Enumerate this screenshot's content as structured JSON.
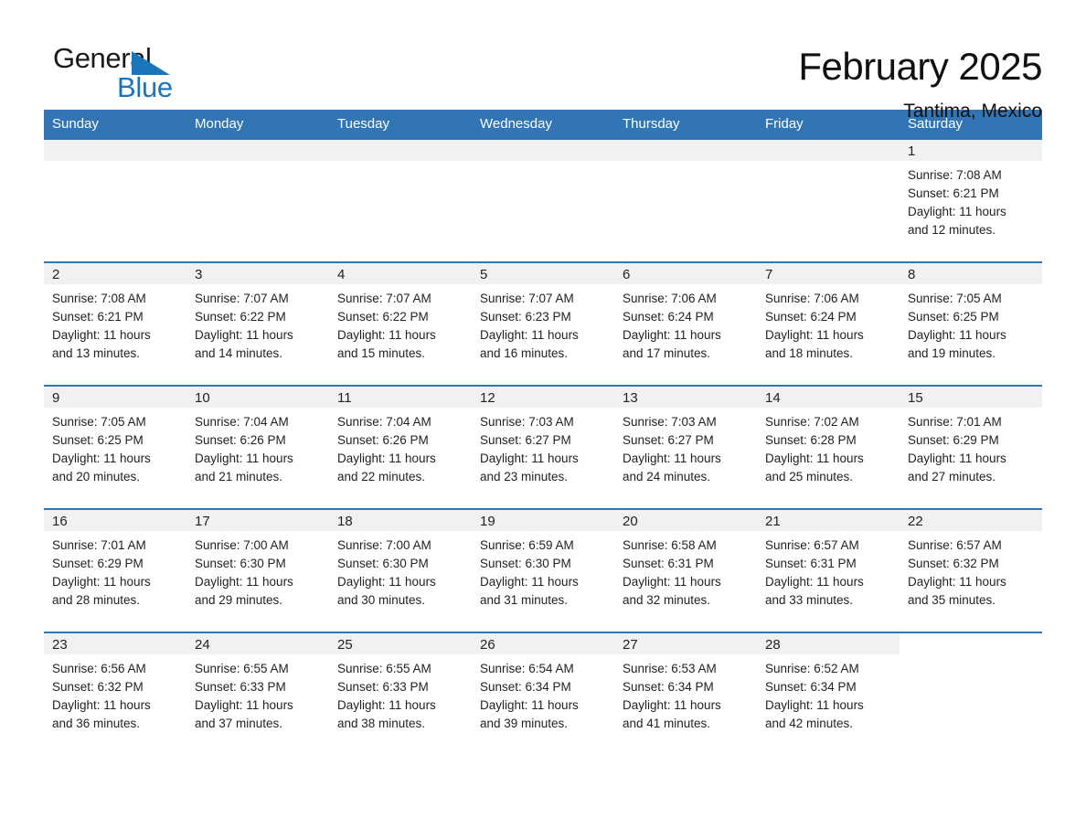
{
  "logo": {
    "word_general": "General",
    "word_blue": "Blue",
    "triangle_color": "#1b75bb"
  },
  "header": {
    "month_title": "February 2025",
    "location": "Tantima, Mexico"
  },
  "theme": {
    "header_blue": "#3175b4",
    "row_border_blue": "#3175b4",
    "daynum_band": "#f1f1f1",
    "text": "#222222"
  },
  "calendar": {
    "weekday_headers": [
      "Sunday",
      "Monday",
      "Tuesday",
      "Wednesday",
      "Thursday",
      "Friday",
      "Saturday"
    ],
    "weeks": [
      [
        {
          "day": "",
          "sunrise": "",
          "sunset": "",
          "daylight_line1": "",
          "daylight_line2": "",
          "blank": true
        },
        {
          "day": "",
          "sunrise": "",
          "sunset": "",
          "daylight_line1": "",
          "daylight_line2": "",
          "blank": true
        },
        {
          "day": "",
          "sunrise": "",
          "sunset": "",
          "daylight_line1": "",
          "daylight_line2": "",
          "blank": true
        },
        {
          "day": "",
          "sunrise": "",
          "sunset": "",
          "daylight_line1": "",
          "daylight_line2": "",
          "blank": true
        },
        {
          "day": "",
          "sunrise": "",
          "sunset": "",
          "daylight_line1": "",
          "daylight_line2": "",
          "blank": true
        },
        {
          "day": "",
          "sunrise": "",
          "sunset": "",
          "daylight_line1": "",
          "daylight_line2": "",
          "blank": true
        },
        {
          "day": "1",
          "sunrise": "Sunrise: 7:08 AM",
          "sunset": "Sunset: 6:21 PM",
          "daylight_line1": "Daylight: 11 hours",
          "daylight_line2": "and 12 minutes."
        }
      ],
      [
        {
          "day": "2",
          "sunrise": "Sunrise: 7:08 AM",
          "sunset": "Sunset: 6:21 PM",
          "daylight_line1": "Daylight: 11 hours",
          "daylight_line2": "and 13 minutes."
        },
        {
          "day": "3",
          "sunrise": "Sunrise: 7:07 AM",
          "sunset": "Sunset: 6:22 PM",
          "daylight_line1": "Daylight: 11 hours",
          "daylight_line2": "and 14 minutes."
        },
        {
          "day": "4",
          "sunrise": "Sunrise: 7:07 AM",
          "sunset": "Sunset: 6:22 PM",
          "daylight_line1": "Daylight: 11 hours",
          "daylight_line2": "and 15 minutes."
        },
        {
          "day": "5",
          "sunrise": "Sunrise: 7:07 AM",
          "sunset": "Sunset: 6:23 PM",
          "daylight_line1": "Daylight: 11 hours",
          "daylight_line2": "and 16 minutes."
        },
        {
          "day": "6",
          "sunrise": "Sunrise: 7:06 AM",
          "sunset": "Sunset: 6:24 PM",
          "daylight_line1": "Daylight: 11 hours",
          "daylight_line2": "and 17 minutes."
        },
        {
          "day": "7",
          "sunrise": "Sunrise: 7:06 AM",
          "sunset": "Sunset: 6:24 PM",
          "daylight_line1": "Daylight: 11 hours",
          "daylight_line2": "and 18 minutes."
        },
        {
          "day": "8",
          "sunrise": "Sunrise: 7:05 AM",
          "sunset": "Sunset: 6:25 PM",
          "daylight_line1": "Daylight: 11 hours",
          "daylight_line2": "and 19 minutes."
        }
      ],
      [
        {
          "day": "9",
          "sunrise": "Sunrise: 7:05 AM",
          "sunset": "Sunset: 6:25 PM",
          "daylight_line1": "Daylight: 11 hours",
          "daylight_line2": "and 20 minutes."
        },
        {
          "day": "10",
          "sunrise": "Sunrise: 7:04 AM",
          "sunset": "Sunset: 6:26 PM",
          "daylight_line1": "Daylight: 11 hours",
          "daylight_line2": "and 21 minutes."
        },
        {
          "day": "11",
          "sunrise": "Sunrise: 7:04 AM",
          "sunset": "Sunset: 6:26 PM",
          "daylight_line1": "Daylight: 11 hours",
          "daylight_line2": "and 22 minutes."
        },
        {
          "day": "12",
          "sunrise": "Sunrise: 7:03 AM",
          "sunset": "Sunset: 6:27 PM",
          "daylight_line1": "Daylight: 11 hours",
          "daylight_line2": "and 23 minutes."
        },
        {
          "day": "13",
          "sunrise": "Sunrise: 7:03 AM",
          "sunset": "Sunset: 6:27 PM",
          "daylight_line1": "Daylight: 11 hours",
          "daylight_line2": "and 24 minutes."
        },
        {
          "day": "14",
          "sunrise": "Sunrise: 7:02 AM",
          "sunset": "Sunset: 6:28 PM",
          "daylight_line1": "Daylight: 11 hours",
          "daylight_line2": "and 25 minutes."
        },
        {
          "day": "15",
          "sunrise": "Sunrise: 7:01 AM",
          "sunset": "Sunset: 6:29 PM",
          "daylight_line1": "Daylight: 11 hours",
          "daylight_line2": "and 27 minutes."
        }
      ],
      [
        {
          "day": "16",
          "sunrise": "Sunrise: 7:01 AM",
          "sunset": "Sunset: 6:29 PM",
          "daylight_line1": "Daylight: 11 hours",
          "daylight_line2": "and 28 minutes."
        },
        {
          "day": "17",
          "sunrise": "Sunrise: 7:00 AM",
          "sunset": "Sunset: 6:30 PM",
          "daylight_line1": "Daylight: 11 hours",
          "daylight_line2": "and 29 minutes."
        },
        {
          "day": "18",
          "sunrise": "Sunrise: 7:00 AM",
          "sunset": "Sunset: 6:30 PM",
          "daylight_line1": "Daylight: 11 hours",
          "daylight_line2": "and 30 minutes."
        },
        {
          "day": "19",
          "sunrise": "Sunrise: 6:59 AM",
          "sunset": "Sunset: 6:30 PM",
          "daylight_line1": "Daylight: 11 hours",
          "daylight_line2": "and 31 minutes."
        },
        {
          "day": "20",
          "sunrise": "Sunrise: 6:58 AM",
          "sunset": "Sunset: 6:31 PM",
          "daylight_line1": "Daylight: 11 hours",
          "daylight_line2": "and 32 minutes."
        },
        {
          "day": "21",
          "sunrise": "Sunrise: 6:57 AM",
          "sunset": "Sunset: 6:31 PM",
          "daylight_line1": "Daylight: 11 hours",
          "daylight_line2": "and 33 minutes."
        },
        {
          "day": "22",
          "sunrise": "Sunrise: 6:57 AM",
          "sunset": "Sunset: 6:32 PM",
          "daylight_line1": "Daylight: 11 hours",
          "daylight_line2": "and 35 minutes."
        }
      ],
      [
        {
          "day": "23",
          "sunrise": "Sunrise: 6:56 AM",
          "sunset": "Sunset: 6:32 PM",
          "daylight_line1": "Daylight: 11 hours",
          "daylight_line2": "and 36 minutes."
        },
        {
          "day": "24",
          "sunrise": "Sunrise: 6:55 AM",
          "sunset": "Sunset: 6:33 PM",
          "daylight_line1": "Daylight: 11 hours",
          "daylight_line2": "and 37 minutes."
        },
        {
          "day": "25",
          "sunrise": "Sunrise: 6:55 AM",
          "sunset": "Sunset: 6:33 PM",
          "daylight_line1": "Daylight: 11 hours",
          "daylight_line2": "and 38 minutes."
        },
        {
          "day": "26",
          "sunrise": "Sunrise: 6:54 AM",
          "sunset": "Sunset: 6:34 PM",
          "daylight_line1": "Daylight: 11 hours",
          "daylight_line2": "and 39 minutes."
        },
        {
          "day": "27",
          "sunrise": "Sunrise: 6:53 AM",
          "sunset": "Sunset: 6:34 PM",
          "daylight_line1": "Daylight: 11 hours",
          "daylight_line2": "and 41 minutes."
        },
        {
          "day": "28",
          "sunrise": "Sunrise: 6:52 AM",
          "sunset": "Sunset: 6:34 PM",
          "daylight_line1": "Daylight: 11 hours",
          "daylight_line2": "and 42 minutes."
        },
        {
          "day": "",
          "sunrise": "",
          "sunset": "",
          "daylight_line1": "",
          "daylight_line2": "",
          "void": true
        }
      ]
    ]
  }
}
